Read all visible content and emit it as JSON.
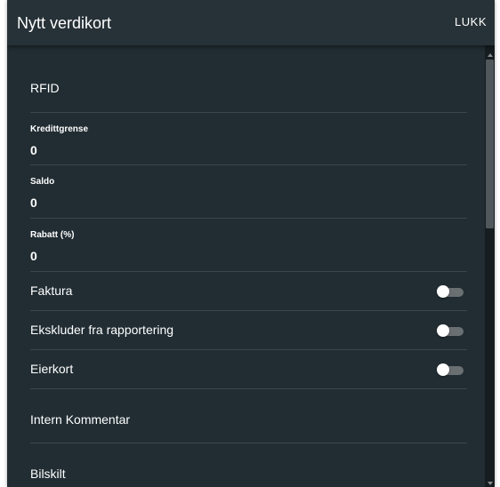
{
  "dialog": {
    "title": "Nytt verdikort",
    "close_label": "LUKK"
  },
  "form": {
    "rfid_label": "RFID",
    "credit_limit": {
      "label": "Kredittgrense",
      "value": "0"
    },
    "balance": {
      "label": "Saldo",
      "value": "0"
    },
    "discount": {
      "label": "Rabatt (%)",
      "value": "0"
    },
    "invoice": {
      "label": "Faktura",
      "enabled": false
    },
    "exclude_reporting": {
      "label": "Ekskluder fra rapportering",
      "enabled": false
    },
    "owner_card": {
      "label": "Eierkort",
      "enabled": false
    },
    "internal_comment_label": "Intern Kommentar",
    "license_plate_label": "Bilskilt"
  },
  "colors": {
    "panel_background": "#212d33",
    "header_background": "#273238",
    "divider": "#3a474d",
    "toggle_track_off": "#6a6f72",
    "text": "#ffffff"
  }
}
